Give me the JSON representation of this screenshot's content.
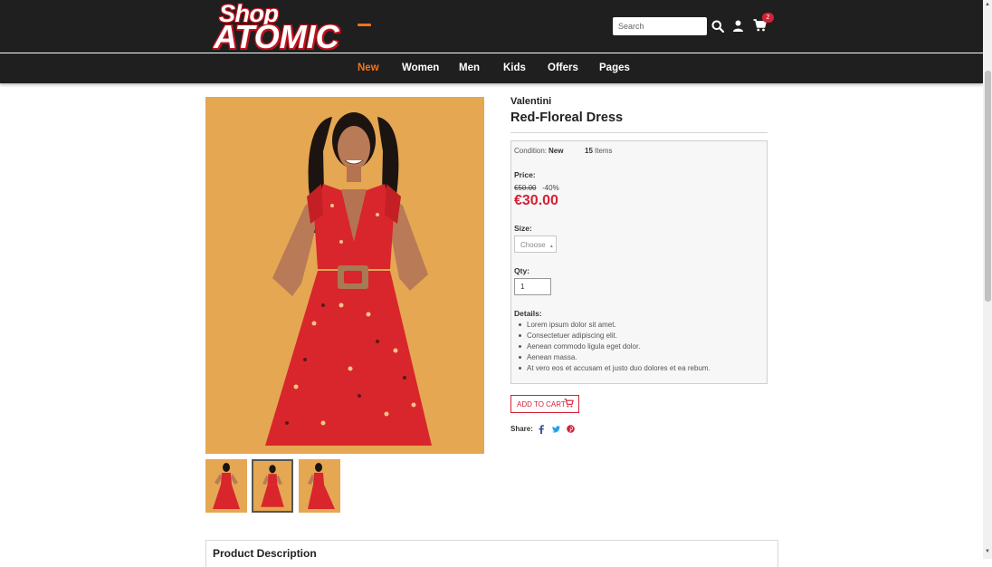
{
  "header": {
    "logo_top": "Shop",
    "logo_bottom": "ATOMIC",
    "search_placeholder": "Search",
    "cart_count": "2"
  },
  "nav": {
    "items": [
      {
        "label": "New",
        "active": true
      },
      {
        "label": "Women"
      },
      {
        "label": "Men"
      },
      {
        "label": "Kids"
      },
      {
        "label": "Offers"
      },
      {
        "label": "Pages"
      }
    ]
  },
  "product": {
    "brand": "Valentini",
    "title": "Red-Floreal Dress",
    "condition_label": "Condition:",
    "condition_value": "New",
    "stock_count": "15",
    "stock_label": "Items",
    "price_label": "Price:",
    "old_price": "€50.00",
    "discount": "-40%",
    "price": "€30.00",
    "size_label": "Size:",
    "size_select": "Choose",
    "qty_label": "Qty:",
    "qty_value": "1",
    "details_label": "Details:",
    "details": [
      "Lorem ipsum dolor sit amet.",
      "Consectetuer adipiscing elit.",
      "Aenean commodo ligula eget dolor.",
      "Aenean massa.",
      "At vero eos et accusam et justo duo dolores et ea rebum."
    ],
    "add_to_cart": "ADD TO CART",
    "share_label": "Share:"
  },
  "description": {
    "title": "Product Description"
  },
  "colors": {
    "accent": "#f2731b",
    "price": "#d32136",
    "header_bg": "#1f1f1f",
    "photo_bg": "#e5a752",
    "dress": "#d8262c"
  },
  "icons": [
    "search-icon",
    "user-icon",
    "cart-icon",
    "facebook-icon",
    "twitter-icon",
    "pinterest-icon"
  ]
}
